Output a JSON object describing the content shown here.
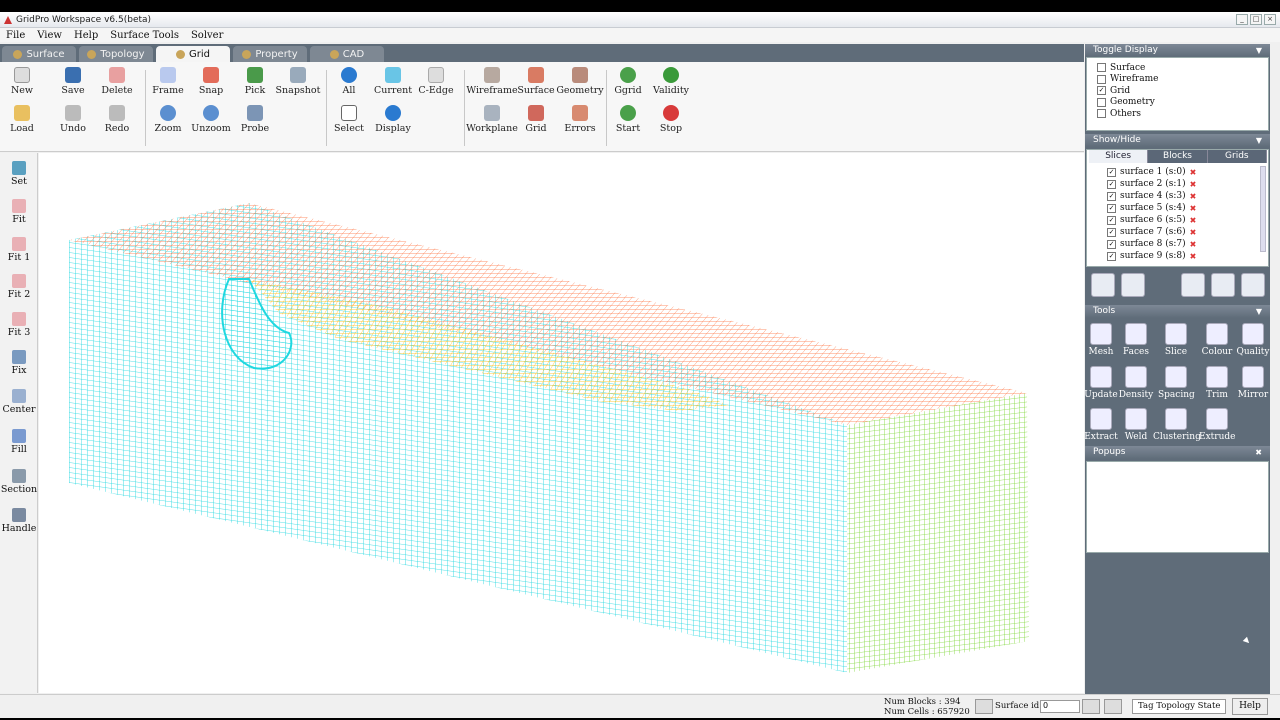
{
  "window": {
    "title": "GridPro Workspace v6.5(beta)"
  },
  "menu": [
    "File",
    "View",
    "Help",
    "Surface Tools",
    "Solver"
  ],
  "tabs": [
    "Surface",
    "Topology",
    "Grid",
    "Property",
    "CAD"
  ],
  "toolbar": {
    "new": "New",
    "save": "Save",
    "delete": "Delete",
    "frame": "Frame",
    "snap": "Snap",
    "pick": "Pick",
    "snapshot": "Snapshot",
    "load": "Load",
    "undo": "Undo",
    "redo": "Redo",
    "zoom": "Zoom",
    "unzoom": "Unzoom",
    "probe": "Probe",
    "all": "All",
    "current": "Current",
    "cedge": "C-Edge",
    "select": "Select",
    "display": "Display",
    "wireframe": "Wireframe",
    "surface": "Surface",
    "geometry": "Geometry",
    "workplane": "Workplane",
    "grid": "Grid",
    "errors": "Errors",
    "ggrid": "Ggrid",
    "validity": "Validity",
    "start": "Start",
    "stop": "Stop"
  },
  "left": [
    "Set",
    "Fit",
    "Fit 1",
    "Fit 2",
    "Fit 3",
    "Fix",
    "Center",
    "Fill",
    "Section",
    "Handle"
  ],
  "toggle_display": {
    "title": "Toggle Display",
    "items": [
      {
        "label": "Surface",
        "checked": false
      },
      {
        "label": "Wireframe",
        "checked": false
      },
      {
        "label": "Grid",
        "checked": true
      },
      {
        "label": "Geometry",
        "checked": false
      },
      {
        "label": "Others",
        "checked": false
      }
    ]
  },
  "show_hide": {
    "title": "Show/Hide",
    "tabs": [
      "Slices",
      "Blocks",
      "Grids"
    ],
    "items": [
      "surface 1 (s:0)",
      "surface 2 (s:1)",
      "surface 4 (s:3)",
      "surface 5 (s:4)",
      "surface 6 (s:5)",
      "surface 7 (s:6)",
      "surface 8 (s:7)",
      "surface 9 (s:8)"
    ]
  },
  "tools": {
    "title": "Tools",
    "items": [
      "Mesh",
      "Faces",
      "Slice",
      "Colour",
      "Quality",
      "Update",
      "Density",
      "Spacing",
      "Trim",
      "Mirror",
      "Extract",
      "Weld",
      "Clustering",
      "Extrude"
    ]
  },
  "popups": {
    "title": "Popups"
  },
  "status": {
    "blocks": "Num Blocks : 394",
    "cells": "Num Cells :   657920",
    "surface_id_label": "Surface id :",
    "surface_id_value": "0",
    "tag_state": "Tag Topology State",
    "help": "Help"
  },
  "colors": {
    "side": "#20d8e0",
    "top": "#ff7a4a",
    "yellow": "#ffc020",
    "end": "#7fd83a"
  }
}
